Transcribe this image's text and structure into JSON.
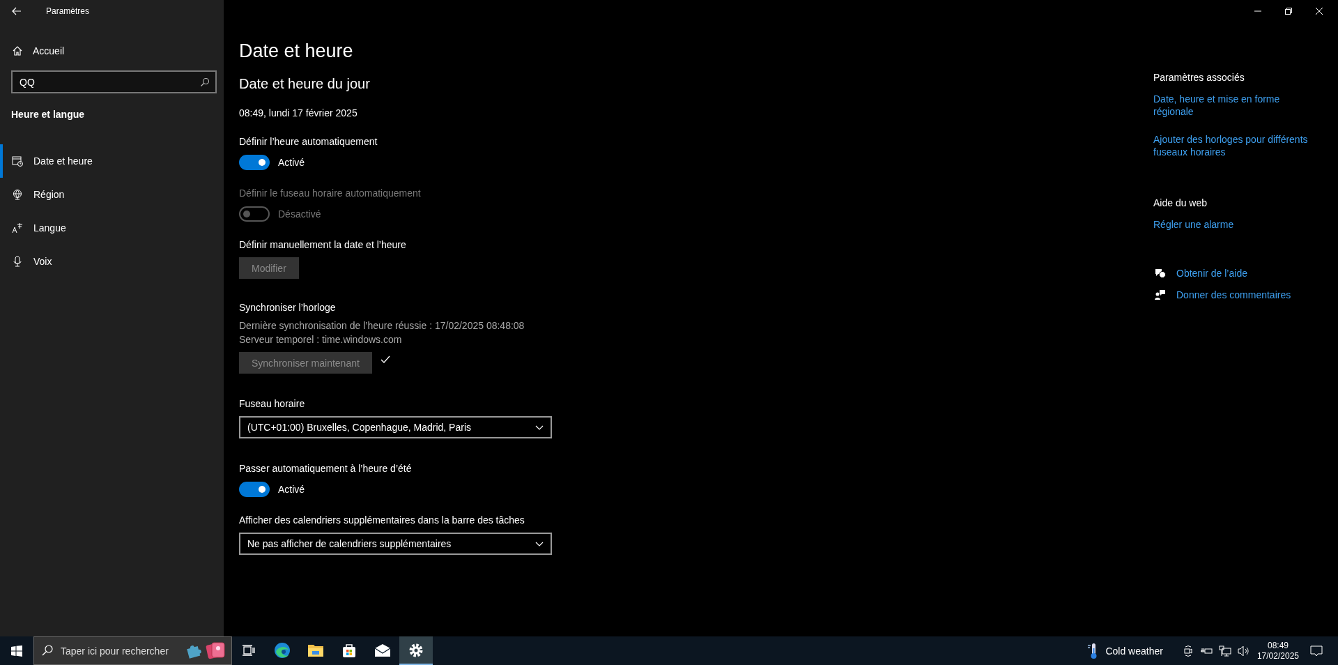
{
  "window": {
    "title": "Paramètres"
  },
  "sidebar": {
    "home": "Accueil",
    "search": {
      "value": "QQ"
    },
    "section": "Heure et langue",
    "items": [
      {
        "label": "Date et heure",
        "kind": "calendar",
        "selected": true
      },
      {
        "label": "Région",
        "kind": "globe",
        "selected": false
      },
      {
        "label": "Langue",
        "kind": "language",
        "selected": false
      },
      {
        "label": "Voix",
        "kind": "mic",
        "selected": false
      }
    ]
  },
  "main": {
    "title": "Date et heure",
    "subtitle": "Date et heure du jour",
    "current": "08:49, lundi 17 février 2025",
    "auto_time": {
      "label": "Définir l’heure automatiquement",
      "on": true,
      "disabled": false,
      "state": "Activé"
    },
    "auto_timezone": {
      "label": "Définir le fuseau horaire automatiquement",
      "on": false,
      "disabled": true,
      "state": "Désactivé"
    },
    "manual": {
      "label": "Définir manuellement la date et l’heure",
      "button": "Modifier",
      "disabled": true
    },
    "sync": {
      "heading": "Synchroniser l’horloge",
      "last": "Dernière synchronisation de l’heure réussie : 17/02/2025 08:48:08",
      "server": "Serveur temporel : time.windows.com",
      "button": "Synchroniser maintenant",
      "disabled": true,
      "done": true
    },
    "timezone": {
      "label": "Fuseau horaire",
      "value": "(UTC+01:00) Bruxelles, Copenhague, Madrid, Paris"
    },
    "dst": {
      "label": "Passer automatiquement à l’heure d’été",
      "on": true,
      "disabled": false,
      "state": "Activé"
    },
    "calendars": {
      "label": "Afficher des calendriers supplémentaires dans la barre des tâches",
      "value": "Ne pas afficher de calendriers supplémentaires"
    }
  },
  "aside": {
    "related": {
      "heading": "Paramètres associés",
      "links": [
        "Date, heure et mise en forme régionale",
        "Ajouter des horloges pour différents fuseaux horaires"
      ]
    },
    "web": {
      "heading": "Aide du web",
      "links": [
        "Régler une alarme"
      ]
    },
    "support": [
      {
        "label": "Obtenir de l’aide",
        "kind": "help"
      },
      {
        "label": "Donner des commentaires",
        "kind": "feedback"
      }
    ]
  },
  "taskbar": {
    "search_placeholder": "Taper ici pour rechercher",
    "apps": [
      {
        "kind": "taskview",
        "selected": false
      },
      {
        "kind": "edge",
        "selected": false
      },
      {
        "kind": "folder",
        "selected": false
      },
      {
        "kind": "store",
        "selected": false
      },
      {
        "kind": "mail",
        "selected": false
      },
      {
        "kind": "settings",
        "selected": true
      }
    ],
    "weather": "Cold weather",
    "time": "08:49",
    "date": "17/02/2025"
  }
}
